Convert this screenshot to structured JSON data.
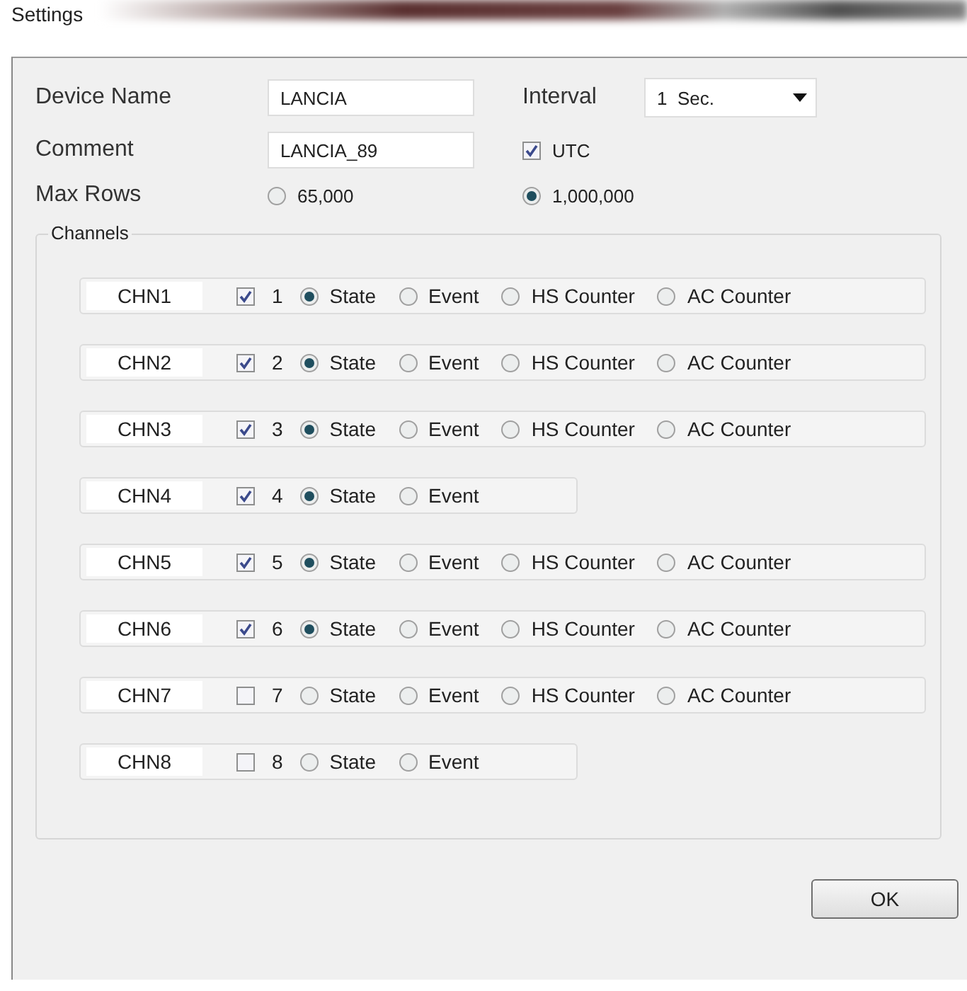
{
  "window": {
    "title": "Settings"
  },
  "device_name": {
    "label": "Device Name",
    "value": "LANCIA"
  },
  "interval": {
    "label": "Interval",
    "value": "1  Sec."
  },
  "comment": {
    "label": "Comment",
    "value": "LANCIA_89"
  },
  "utc": {
    "label": "UTC",
    "checked": true
  },
  "max_rows": {
    "label": "Max Rows",
    "options": [
      {
        "label": "65,000",
        "selected": false
      },
      {
        "label": "1,000,000",
        "selected": true
      }
    ]
  },
  "channels": {
    "title": "Channels",
    "rows": [
      {
        "name": "CHN1",
        "number": "1",
        "checked": true,
        "options": [
          {
            "label": "State",
            "selected": true
          },
          {
            "label": "Event",
            "selected": false
          },
          {
            "label": "HS Counter",
            "selected": false
          },
          {
            "label": "AC Counter",
            "selected": false
          }
        ]
      },
      {
        "name": "CHN2",
        "number": "2",
        "checked": true,
        "options": [
          {
            "label": "State",
            "selected": true
          },
          {
            "label": "Event",
            "selected": false
          },
          {
            "label": "HS Counter",
            "selected": false
          },
          {
            "label": "AC Counter",
            "selected": false
          }
        ]
      },
      {
        "name": "CHN3",
        "number": "3",
        "checked": true,
        "options": [
          {
            "label": "State",
            "selected": true
          },
          {
            "label": "Event",
            "selected": false
          },
          {
            "label": "HS Counter",
            "selected": false
          },
          {
            "label": "AC Counter",
            "selected": false
          }
        ]
      },
      {
        "name": "CHN4",
        "number": "4",
        "checked": true,
        "options": [
          {
            "label": "State",
            "selected": true
          },
          {
            "label": "Event",
            "selected": false
          }
        ]
      },
      {
        "name": "CHN5",
        "number": "5",
        "checked": true,
        "options": [
          {
            "label": "State",
            "selected": true
          },
          {
            "label": "Event",
            "selected": false
          },
          {
            "label": "HS Counter",
            "selected": false
          },
          {
            "label": "AC Counter",
            "selected": false
          }
        ]
      },
      {
        "name": "CHN6",
        "number": "6",
        "checked": true,
        "options": [
          {
            "label": "State",
            "selected": true
          },
          {
            "label": "Event",
            "selected": false
          },
          {
            "label": "HS Counter",
            "selected": false
          },
          {
            "label": "AC Counter",
            "selected": false
          }
        ]
      },
      {
        "name": "CHN7",
        "number": "7",
        "checked": false,
        "options": [
          {
            "label": "State",
            "selected": false
          },
          {
            "label": "Event",
            "selected": false
          },
          {
            "label": "HS Counter",
            "selected": false
          },
          {
            "label": "AC Counter",
            "selected": false
          }
        ]
      },
      {
        "name": "CHN8",
        "number": "8",
        "checked": false,
        "options": [
          {
            "label": "State",
            "selected": false
          },
          {
            "label": "Event",
            "selected": false
          }
        ]
      }
    ]
  },
  "buttons": [
    "OK"
  ]
}
